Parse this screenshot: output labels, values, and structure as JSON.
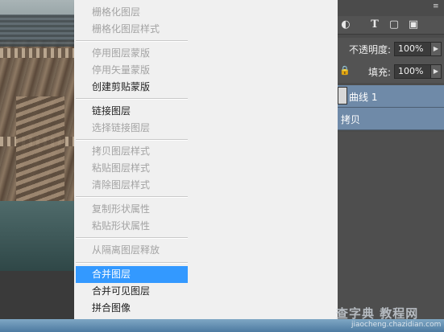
{
  "menu": {
    "items": [
      {
        "label": "栅格化图层",
        "enabled": false
      },
      {
        "label": "栅格化图层样式",
        "enabled": false
      },
      {
        "label": "停用图层蒙版",
        "enabled": false
      },
      {
        "label": "停用矢量蒙版",
        "enabled": false
      },
      {
        "label": "创建剪贴蒙版",
        "enabled": true
      },
      {
        "label": "链接图层",
        "enabled": true
      },
      {
        "label": "选择链接图层",
        "enabled": false
      },
      {
        "label": "拷贝图层样式",
        "enabled": false
      },
      {
        "label": "粘贴图层样式",
        "enabled": false
      },
      {
        "label": "清除图层样式",
        "enabled": false
      },
      {
        "label": "复制形状属性",
        "enabled": false
      },
      {
        "label": "粘贴形状属性",
        "enabled": false
      },
      {
        "label": "从隔离图层释放",
        "enabled": false
      },
      {
        "label": "合并图层",
        "enabled": true,
        "highlighted": true
      },
      {
        "label": "合并可见图层",
        "enabled": true
      },
      {
        "label": "拼合图像",
        "enabled": true
      }
    ]
  },
  "layers_panel": {
    "opacity_label": "不透明度:",
    "opacity_value": "100%",
    "fill_label": "填充:",
    "fill_value": "100%",
    "layers": [
      {
        "name": "曲线 1",
        "selected": true
      },
      {
        "name": "拷贝",
        "selected": true
      }
    ],
    "filter_icons": [
      "circle-half-icon",
      "text-icon",
      "shape-icon",
      "smart-object-icon"
    ]
  },
  "watermark": {
    "site": "查字典 教程网",
    "url": "jiaocheng.chazidian.com"
  },
  "colors": {
    "menu_bg": "#f0f0f0",
    "highlight": "#3399ff",
    "panel_bg": "#535353",
    "layer_selected": "#6f8aa8"
  }
}
